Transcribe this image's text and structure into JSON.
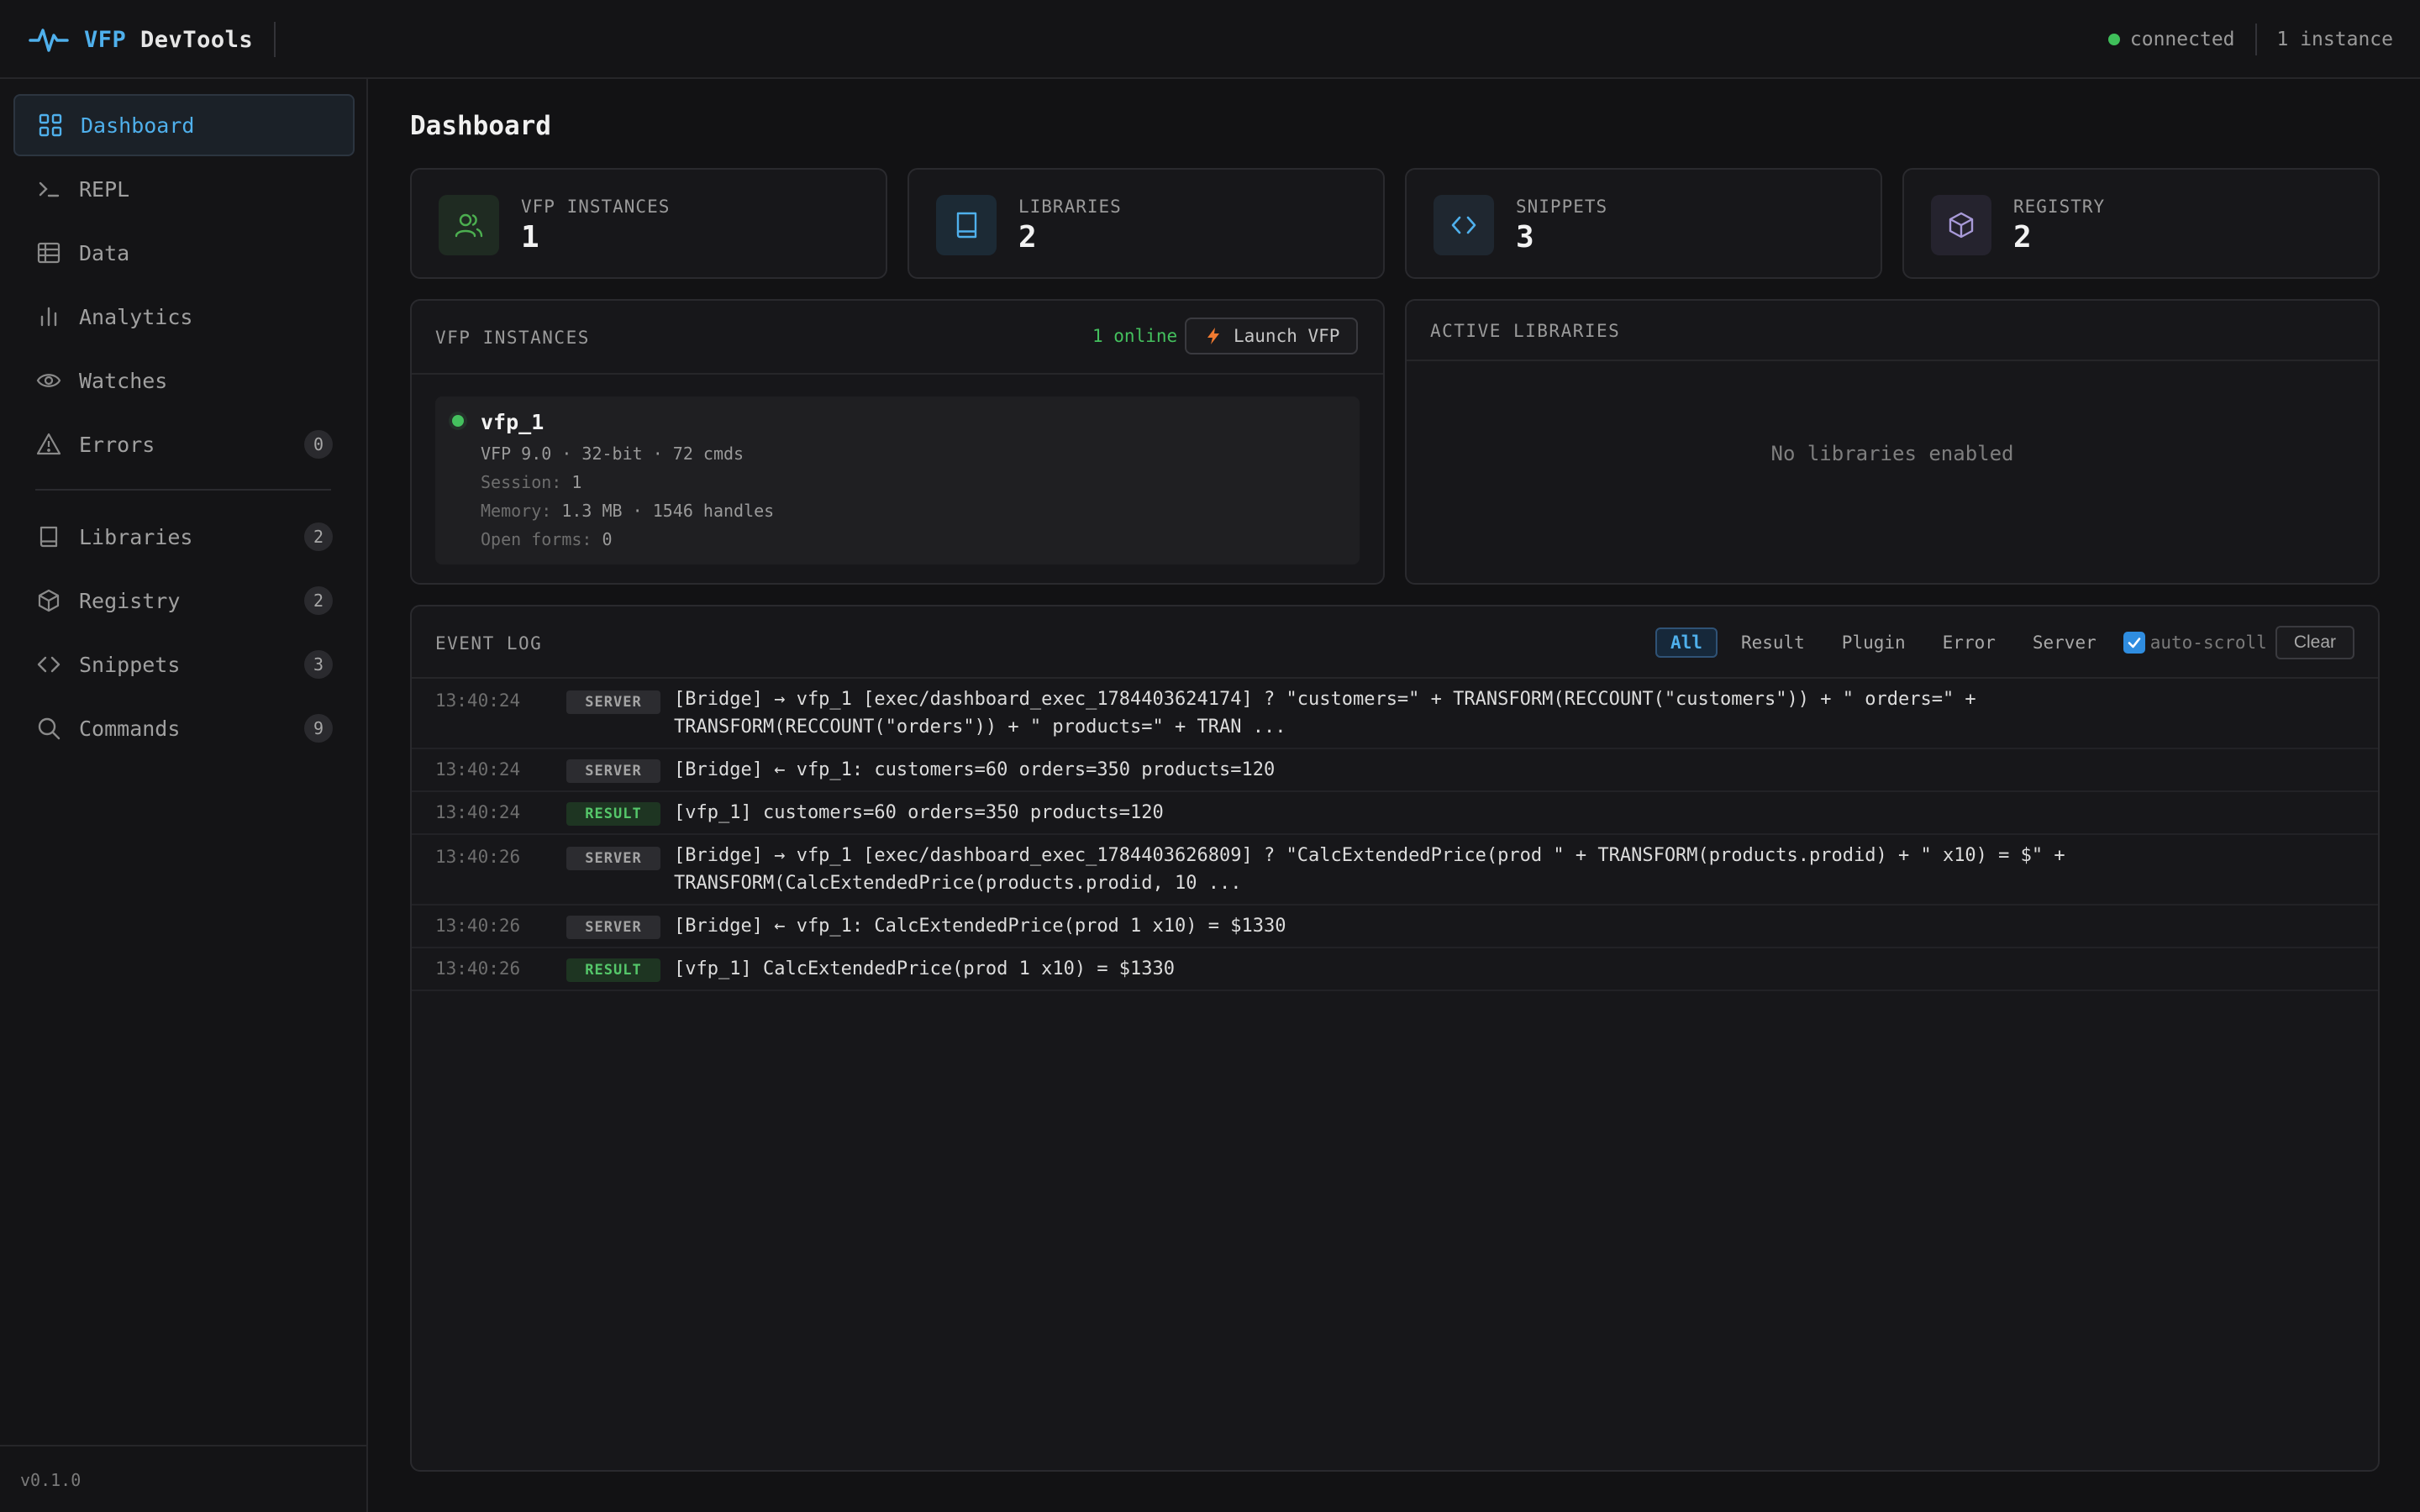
{
  "header": {
    "brand_accent": "VFP",
    "brand_rest": "DevTools",
    "status_text": "connected",
    "instances_text": "1 instance"
  },
  "sidebar": {
    "items": [
      {
        "label": "Dashboard",
        "icon": "dashboard-icon",
        "badge": null,
        "active": true
      },
      {
        "label": "REPL",
        "icon": "terminal-icon",
        "badge": null
      },
      {
        "label": "Data",
        "icon": "table-icon",
        "badge": null
      },
      {
        "label": "Analytics",
        "icon": "bar-chart-icon",
        "badge": null
      },
      {
        "label": "Watches",
        "icon": "eye-icon",
        "badge": null
      },
      {
        "label": "Errors",
        "icon": "warning-icon",
        "badge": "0"
      },
      {
        "label": "Libraries",
        "icon": "book-icon",
        "badge": "2"
      },
      {
        "label": "Registry",
        "icon": "package-icon",
        "badge": "2"
      },
      {
        "label": "Snippets",
        "icon": "code-icon",
        "badge": "3"
      },
      {
        "label": "Commands",
        "icon": "search-icon",
        "badge": "9"
      }
    ],
    "version": "v0.1.0"
  },
  "main": {
    "title": "Dashboard",
    "stats": [
      {
        "label": "VFP INSTANCES",
        "value": "1",
        "icon": "users-icon",
        "color": "#4caf50"
      },
      {
        "label": "LIBRARIES",
        "value": "2",
        "icon": "book-icon",
        "color": "#4fb0ec"
      },
      {
        "label": "SNIPPETS",
        "value": "3",
        "icon": "code-icon",
        "color": "#4fb0ec"
      },
      {
        "label": "REGISTRY",
        "value": "2",
        "icon": "package-icon",
        "color": "#a89ad8"
      }
    ],
    "instances_panel": {
      "title": "VFP INSTANCES",
      "online": "1 online",
      "launch_label": "Launch VFP",
      "instance": {
        "name": "vfp_1",
        "info": "VFP 9.0 · 32-bit · 72 cmds",
        "session_label": "Session:",
        "session_value": "1",
        "memory_label": "Memory:",
        "memory_value": "1.3 MB · 1546 handles",
        "forms_label": "Open forms:",
        "forms_value": "0"
      }
    },
    "libraries_panel": {
      "title": "ACTIVE LIBRARIES",
      "empty": "No libraries enabled"
    },
    "event_log": {
      "title": "EVENT LOG",
      "filters": [
        "All",
        "Result",
        "Plugin",
        "Error",
        "Server"
      ],
      "active_filter": "All",
      "auto_scroll_label": "auto-scroll",
      "auto_scroll_checked": true,
      "clear_label": "Clear",
      "rows": [
        {
          "time": "13:40:24",
          "tag": "SERVER",
          "msg": "[Bridge] → vfp_1 [exec/dashboard_exec_1784403624174] ? \"customers=\" + TRANSFORM(RECCOUNT(\"customers\")) + \" orders=\" + TRANSFORM(RECCOUNT(\"orders\")) + \" products=\" + TRAN ..."
        },
        {
          "time": "13:40:24",
          "tag": "SERVER",
          "msg": "[Bridge] ← vfp_1: customers=60 orders=350 products=120"
        },
        {
          "time": "13:40:24",
          "tag": "RESULT",
          "msg": "[vfp_1] customers=60 orders=350 products=120"
        },
        {
          "time": "13:40:26",
          "tag": "SERVER",
          "msg": "[Bridge] → vfp_1 [exec/dashboard_exec_1784403626809] ? \"CalcExtendedPrice(prod \" + TRANSFORM(products.prodid) + \" x10) = $\" + TRANSFORM(CalcExtendedPrice(products.prodid, 10 ..."
        },
        {
          "time": "13:40:26",
          "tag": "SERVER",
          "msg": "[Bridge] ← vfp_1: CalcExtendedPrice(prod 1 x10) = $1330"
        },
        {
          "time": "13:40:26",
          "tag": "RESULT",
          "msg": "[vfp_1] CalcExtendedPrice(prod 1 x10) = $1330"
        }
      ]
    }
  },
  "colors": {
    "accent": "#4fb0ec",
    "online": "#44c05e",
    "background": "#121214"
  }
}
